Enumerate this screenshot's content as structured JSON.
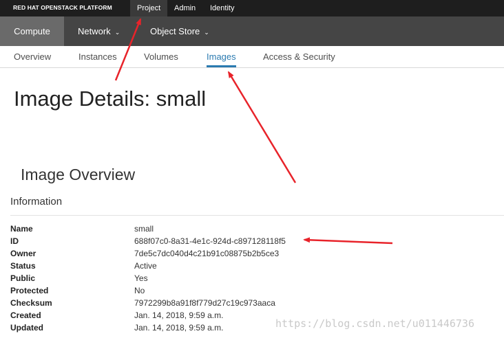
{
  "topbar": {
    "brand": "RED HAT OPENSTACK PLATFORM",
    "tabs": [
      {
        "label": "Project",
        "active": true
      },
      {
        "label": "Admin",
        "active": false
      },
      {
        "label": "Identity",
        "active": false
      }
    ]
  },
  "navbar": {
    "tabs": [
      {
        "label": "Compute",
        "active": true
      },
      {
        "label": "Network",
        "active": false
      },
      {
        "label": "Object Store",
        "active": false
      }
    ]
  },
  "subnav": {
    "tabs": [
      {
        "label": "Overview",
        "active": false
      },
      {
        "label": "Instances",
        "active": false
      },
      {
        "label": "Volumes",
        "active": false
      },
      {
        "label": "Images",
        "active": true
      },
      {
        "label": "Access & Security",
        "active": false
      }
    ]
  },
  "page": {
    "title": "Image Details: small",
    "section_title": "Image Overview",
    "info_title": "Information"
  },
  "details": [
    {
      "key": "Name",
      "value": "small"
    },
    {
      "key": "ID",
      "value": "688f07c0-8a31-4e1c-924d-c897128118f5"
    },
    {
      "key": "Owner",
      "value": "7de5c7dc040d4c21b91c08875b2b5ce3"
    },
    {
      "key": "Status",
      "value": "Active"
    },
    {
      "key": "Public",
      "value": "Yes"
    },
    {
      "key": "Protected",
      "value": "No"
    },
    {
      "key": "Checksum",
      "value": "7972299b8a91f8f779d27c19c973aaca"
    },
    {
      "key": "Created",
      "value": "Jan. 14, 2018, 9:59 a.m."
    },
    {
      "key": "Updated",
      "value": "Jan. 14, 2018, 9:59 a.m."
    }
  ],
  "watermark": "https://blog.csdn.net/u011446736",
  "colors": {
    "accent": "#2a7ab0",
    "annotation": "#e8232a"
  },
  "icons": {
    "dropdown": "chevron-down-icon"
  }
}
